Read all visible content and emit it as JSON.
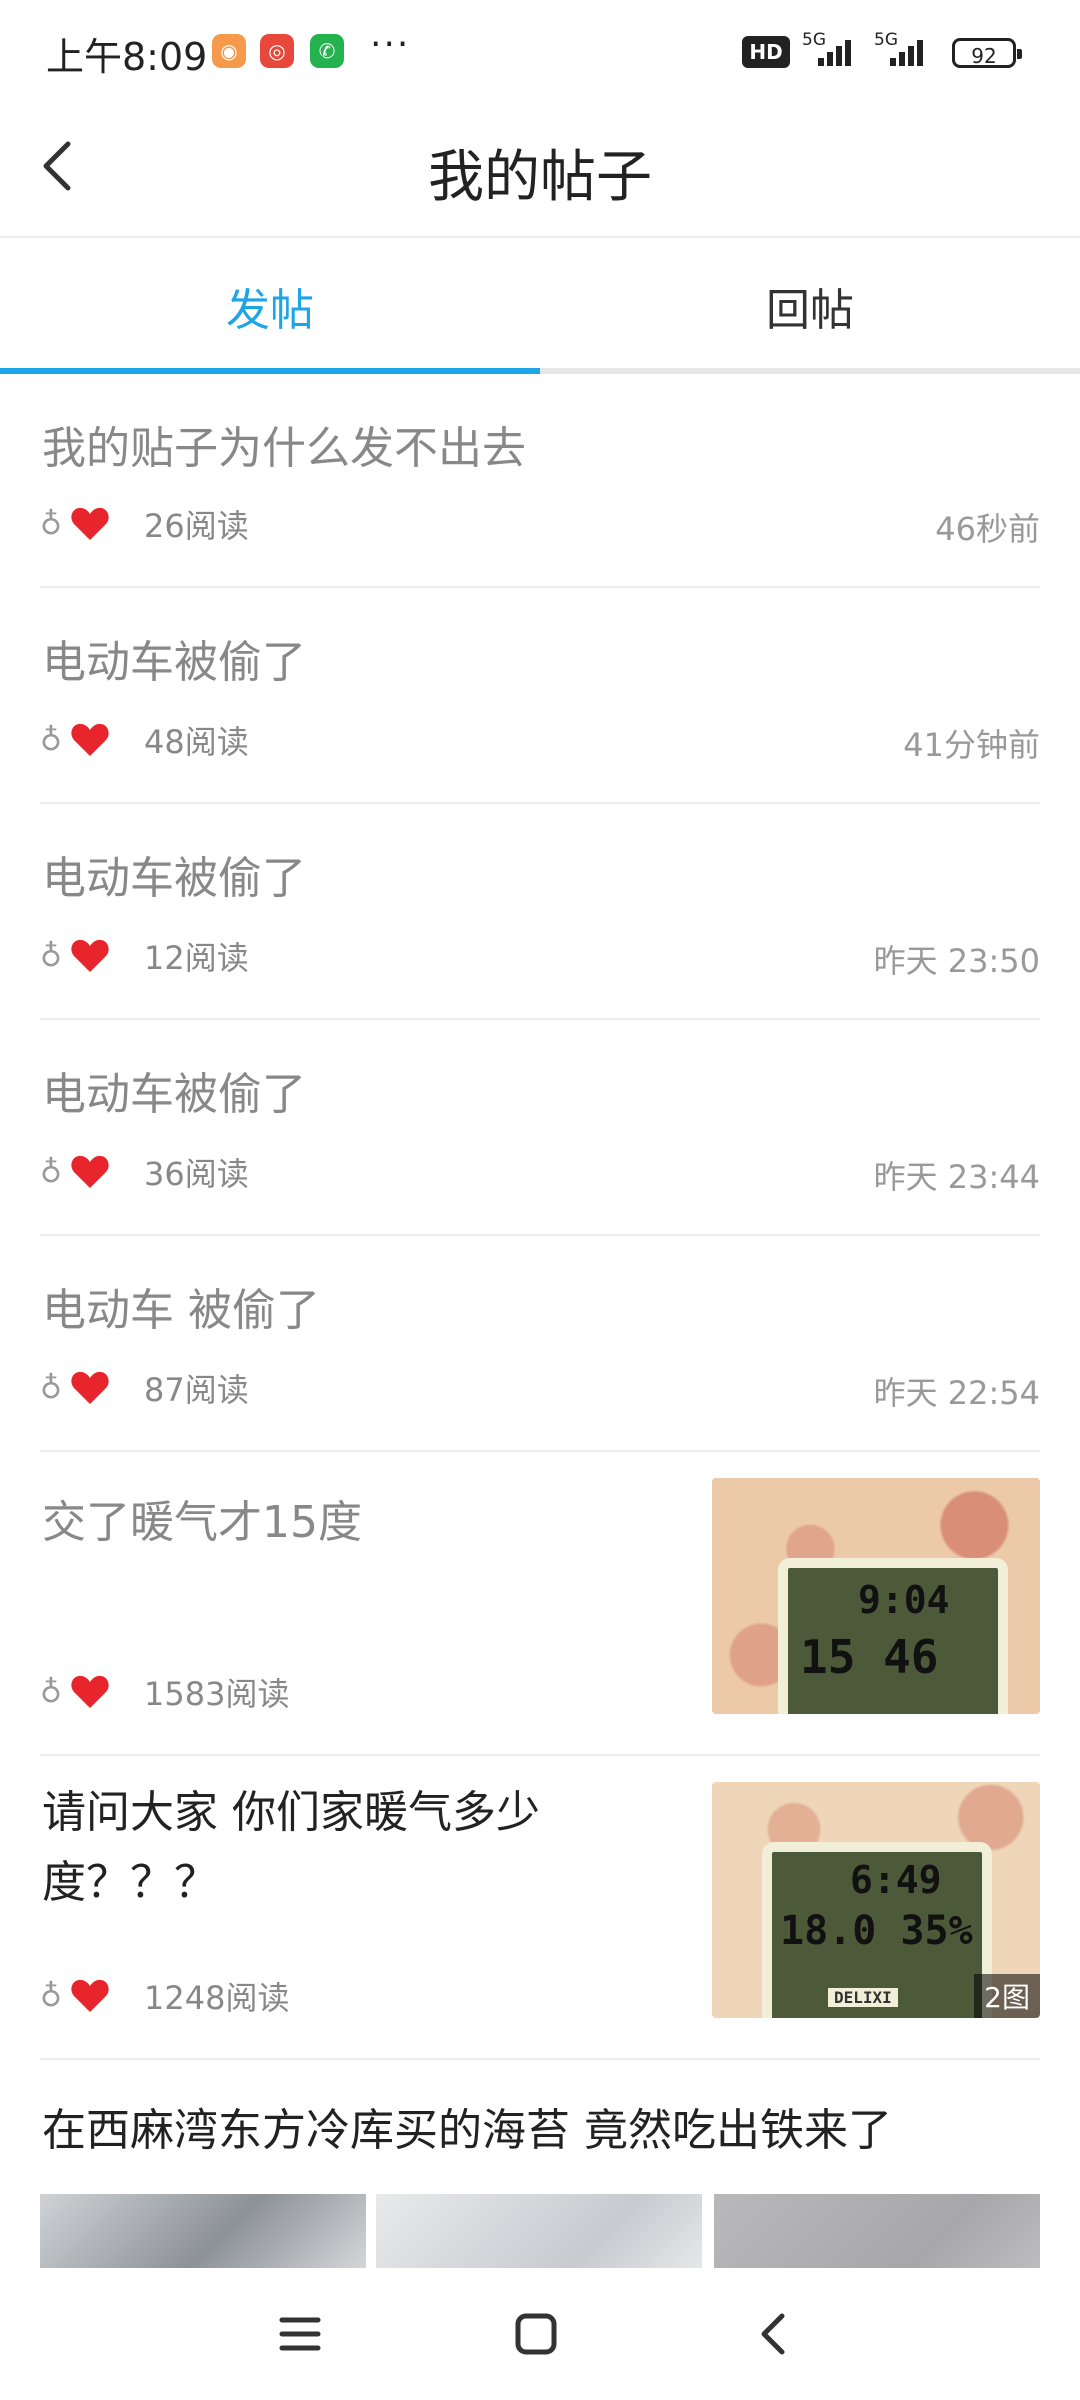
{
  "status_bar": {
    "time": "上午8:09",
    "hd": "HD",
    "network1": "5G",
    "network2": "5G",
    "battery": "92",
    "more": "···"
  },
  "header": {
    "title": "我的帖子"
  },
  "tabs": [
    {
      "label": "发帖",
      "active": true
    },
    {
      "label": "回帖",
      "active": false
    }
  ],
  "posts": [
    {
      "title": "我的贴子为什么发不出去",
      "reads": "26阅读",
      "time": "46秒前"
    },
    {
      "title": "电动车被偷了",
      "reads": "48阅读",
      "time": "41分钟前"
    },
    {
      "title": "电动车被偷了",
      "reads": "12阅读",
      "time": "昨天 23:50"
    },
    {
      "title": "电动车被偷了",
      "reads": "36阅读",
      "time": "昨天 23:44"
    },
    {
      "title": "电动车 被偷了",
      "reads": "87阅读",
      "time": "昨天 22:54"
    },
    {
      "title": "交了暖气才15度",
      "reads": "1583阅读",
      "thumb_text_top": "9:04",
      "thumb_text_bottom": "15 46"
    },
    {
      "title": "请问大家 你们家暖气多少度？？？",
      "reads": "1248阅读",
      "image_count": "2图",
      "thumb_text_top": "6:49",
      "thumb_text_bottom": "18.0 35%",
      "thumb_brand": "DELIXI"
    },
    {
      "title": "在西麻湾东方冷库买的海苔 竟然吃出铁来了"
    }
  ],
  "colors": {
    "accent": "#1ea5e8",
    "heart": "#e8252c"
  }
}
